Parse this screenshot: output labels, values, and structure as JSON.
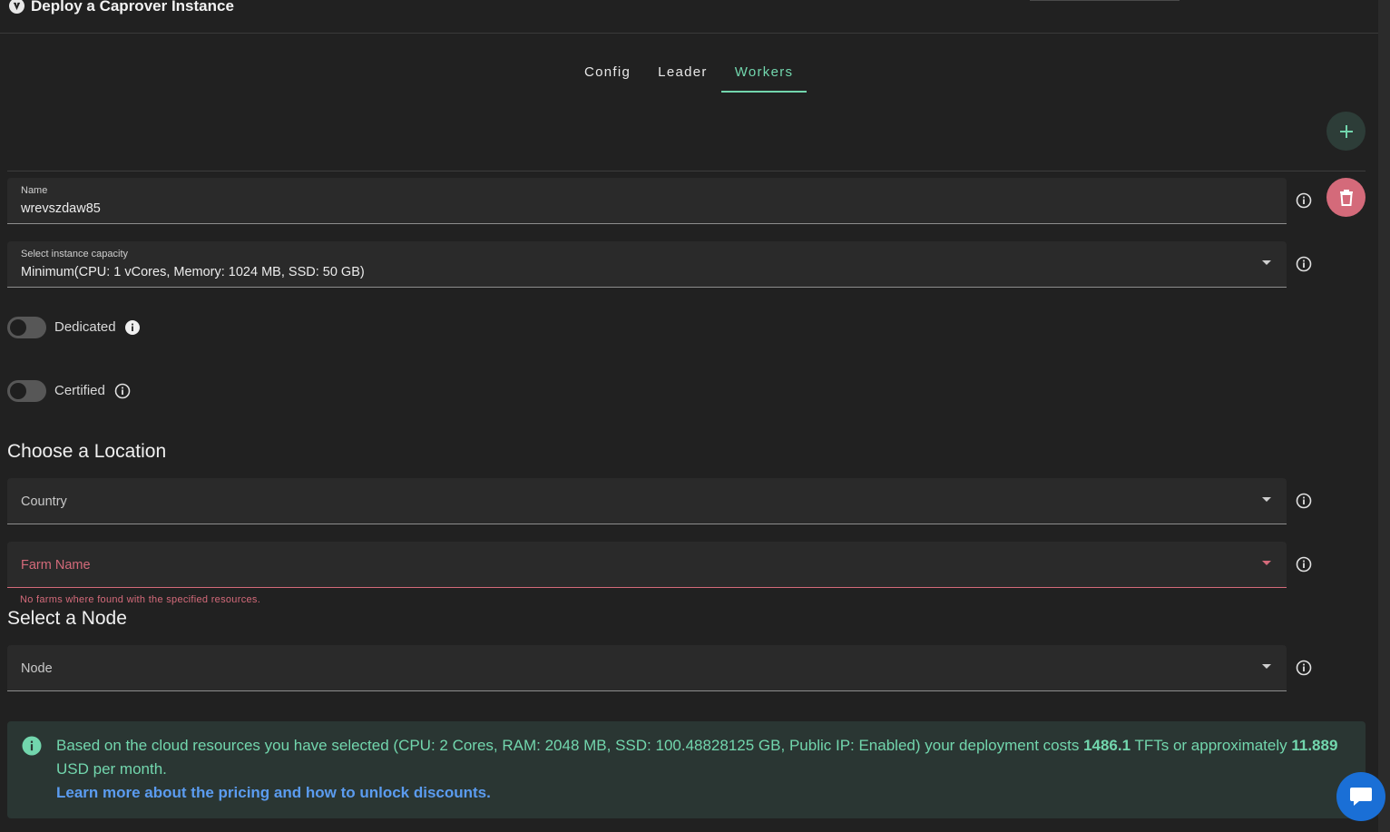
{
  "app": {
    "title": "Deploy a Caprover Instance"
  },
  "tabs": [
    {
      "label": "Config"
    },
    {
      "label": "Leader"
    },
    {
      "label": "Workers"
    }
  ],
  "active_tab": "Workers",
  "worker": {
    "name_label": "Name",
    "name_value": "wrevszdaw85",
    "capacity_label": "Select instance capacity",
    "capacity_value": "Minimum(CPU: 1 vCores, Memory: 1024 MB, SSD: 50 GB)",
    "dedicated_label": "Dedicated",
    "dedicated_on": false,
    "certified_label": "Certified",
    "certified_on": false
  },
  "location": {
    "title": "Choose a Location",
    "country_placeholder": "Country",
    "farm_placeholder": "Farm Name",
    "farm_error": "No farms where found with the specified resources."
  },
  "node": {
    "title": "Select a Node",
    "node_placeholder": "Node"
  },
  "pricing": {
    "text_before": "Based on the cloud resources you have selected (CPU: 2 Cores, RAM: 2048 MB, SSD: 100.48828125 GB, Public IP: Enabled) your deployment costs ",
    "tft_cost": "1486.1",
    "text_middle": " TFTs or approximately ",
    "usd_cost": "11.889",
    "text_after": " USD per month.",
    "link_text": "Learn more about the pricing and how to unlock discounts."
  },
  "colors": {
    "accent": "#72d6ad",
    "error": "#d46a7a",
    "link": "#5b9cf0",
    "chat": "#1a6fd6"
  },
  "icons": [
    "app-logo-icon",
    "plus-icon",
    "trash-icon",
    "info-circle-icon",
    "info-filled-icon",
    "chevron-down-icon",
    "chat-icon"
  ]
}
